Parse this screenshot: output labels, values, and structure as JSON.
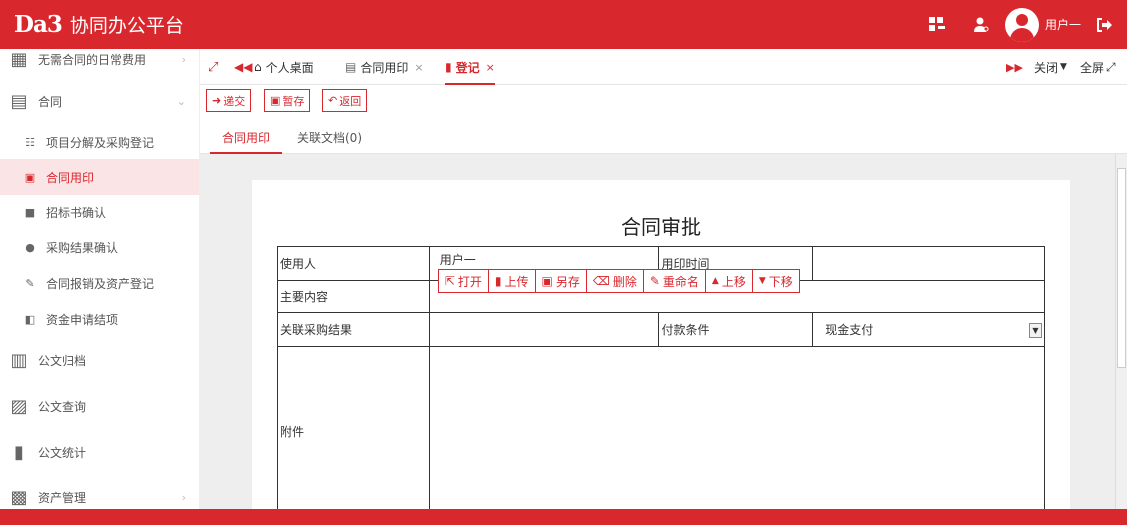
{
  "app": {
    "logo_mark": "Da3",
    "title": "协同办公平台",
    "username": "用户一"
  },
  "sidebar": {
    "items": [
      {
        "label": "无需合同的日常费用",
        "icon": "grid-icon"
      },
      {
        "label": "合同",
        "icon": "document-icon"
      },
      {
        "label": "项目分解及采购登记",
        "icon": "list-icon"
      },
      {
        "label": "合同用印",
        "icon": "stamp-icon"
      },
      {
        "label": "招标书确认",
        "icon": "file-icon"
      },
      {
        "label": "采购结果确认",
        "icon": "plus-circle-icon"
      },
      {
        "label": "合同报销及资产登记",
        "icon": "edit-icon"
      },
      {
        "label": "资金申请结项",
        "icon": "folder-icon"
      },
      {
        "label": "公文归档",
        "icon": "archive-icon"
      },
      {
        "label": "公文查询",
        "icon": "search-doc-icon"
      },
      {
        "label": "公文统计",
        "icon": "bar-chart-icon"
      },
      {
        "label": "资产管理",
        "icon": "asset-icon"
      }
    ]
  },
  "tabs": {
    "items": [
      {
        "label": "个人桌面"
      },
      {
        "label": "合同用印",
        "close": "×"
      },
      {
        "label": "登记",
        "close": "×"
      }
    ],
    "close_label": "关闭",
    "fullscreen_label": "全屏"
  },
  "actions": {
    "submit": "递交",
    "save_draft": "暂存",
    "back": "返回"
  },
  "inner_tabs": {
    "seal": "合同用印",
    "related_docs": "关联文档(0)"
  },
  "form": {
    "title": "合同审批",
    "user_label": "使用人",
    "user_value": "用户一",
    "seal_time_label": "用印时间",
    "seal_time_value": "",
    "main_content_label": "主要内容",
    "main_content_value": "",
    "related_purchase_label": "关联采购结果",
    "related_purchase_value": "",
    "payment_label": "付款条件",
    "payment_value": "现金支付",
    "attachment_label": "附件",
    "tools": {
      "open": "打开",
      "upload": "上传",
      "save_as": "另存",
      "delete": "删除",
      "rename": "重命名",
      "move_up": "上移",
      "move_down": "下移"
    }
  },
  "colors": {
    "brand": "#d9272e",
    "active_bg": "#fbe4e5"
  }
}
